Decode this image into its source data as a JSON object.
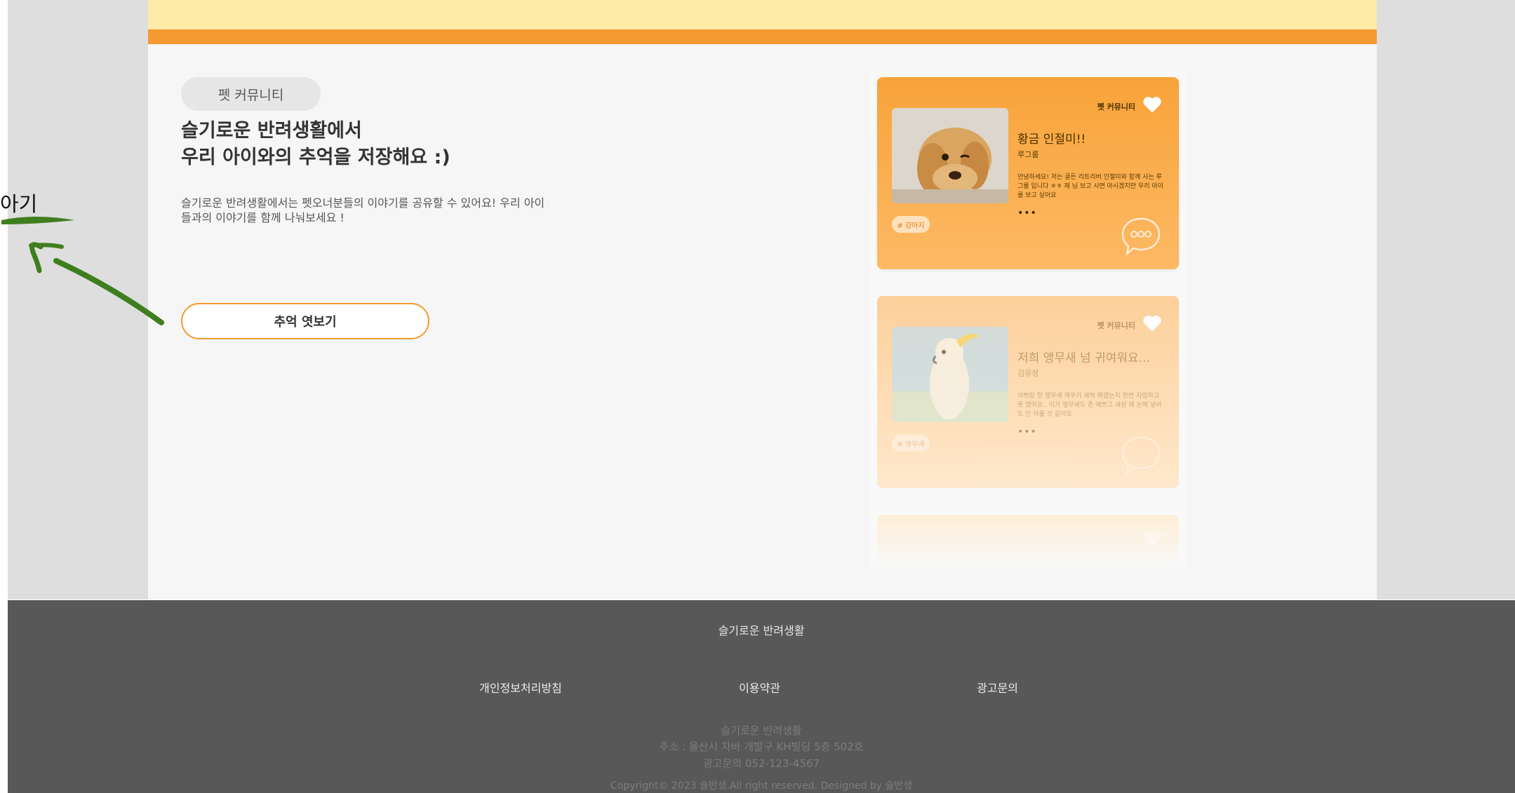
{
  "annotation": {
    "text": "아기"
  },
  "hero": {
    "pill_label": "펫 커뮤니티",
    "headline_line1": "슬기로운 반려생활에서",
    "headline_line2": "우리 아이와의 추억을 저장해요 :)",
    "description_line1": "슬기로운 반려생활에서는 펫오너분들의 이야기를 공유할 수 있어요! 우리 아이",
    "description_line2": "들과의 이야기를 함께 나눠보세요 !",
    "button_label": "추억 엿보기"
  },
  "cards": [
    {
      "category": "펫 커뮤니티",
      "title": "황금 인절미!!",
      "author": "루그룸",
      "body": "안녕하세요! 저는 골든 리트리버 인절미와 함께 사는 루그룸 입니다 ㅎㅎ 제 님 보고 시면 아시겠지만 우리 아이를 보고 싶어요",
      "ellipsis": "•••",
      "tag": "# 강아지"
    },
    {
      "category": "펫 커뮤니티",
      "title": "저희 앵무새 넘 귀여워요...",
      "author": "김유정",
      "body": "이쁘장 한 앵무새 깨꾸기 새싹 뭐였는지 한번 자랑하고 못 했어요.. 이거 앵무새도 존 예쁘고 새삼 제 눈에 넣어도 안 아플 것 같아요",
      "ellipsis": "•••",
      "tag": "# 앵무새"
    }
  ],
  "footer": {
    "brand": "슬기로운 반려생활",
    "links": [
      "개인정보처리방침",
      "이용약관",
      "광고문의"
    ],
    "company": "슬기로운 반려생활",
    "address": "주소 : 울산시 자바 개발구 KH빌딩 5층 502호",
    "contact": "광고문의 052-123-4567",
    "copyright": "Copyright© 2023 슬반생.All right reserved. Designed by 슬반생"
  },
  "colors": {
    "accent_orange": "#f49a30",
    "top_band": "#ffeaa8",
    "footer_bg": "#585858",
    "annotation_arrow": "#3f7e1e"
  },
  "icons": [
    "heart-icon",
    "comment-bubble-icon",
    "arrow-annotation"
  ]
}
